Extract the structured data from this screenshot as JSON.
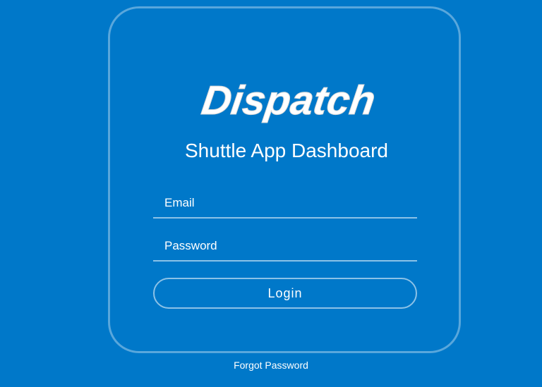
{
  "brand": {
    "logo_text": "Dispatch"
  },
  "login": {
    "title": "Shuttle App Dashboard",
    "email_placeholder": "Email",
    "password_placeholder": "Password",
    "login_label": "Login",
    "forgot_password_label": "Forgot Password"
  },
  "colors": {
    "background": "#0078c9",
    "text": "#ffffff"
  }
}
